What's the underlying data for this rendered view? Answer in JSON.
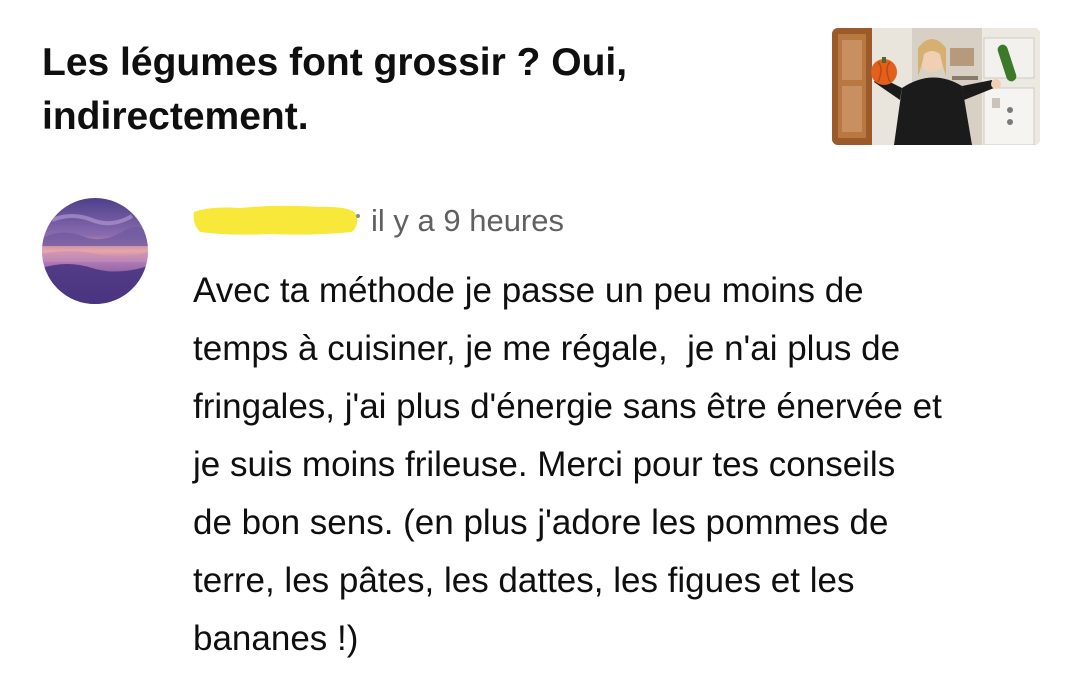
{
  "video": {
    "title_line1": "Les légumes font grossir ? Oui,",
    "title_line2": "indirectement.",
    "thumbnail_icon": "video-thumbnail-woman-with-vegetables"
  },
  "comment": {
    "avatar_icon": "sunset-avatar",
    "author_redacted": true,
    "redaction_color": "#f7e83a",
    "time": "il y a 9 heures",
    "text_lines": [
      "Avec ta méthode je passe un peu moins de",
      "temps à cuisiner, je me régale,  je n'ai plus de",
      "fringales, j'ai plus d'énergie sans être énervée et",
      "je suis moins frileuse. Merci pour tes conseils",
      "de bon sens. (en plus j'adore les pommes de",
      "terre, les pâtes, les dattes, les figues et les",
      "bananes !)"
    ]
  }
}
